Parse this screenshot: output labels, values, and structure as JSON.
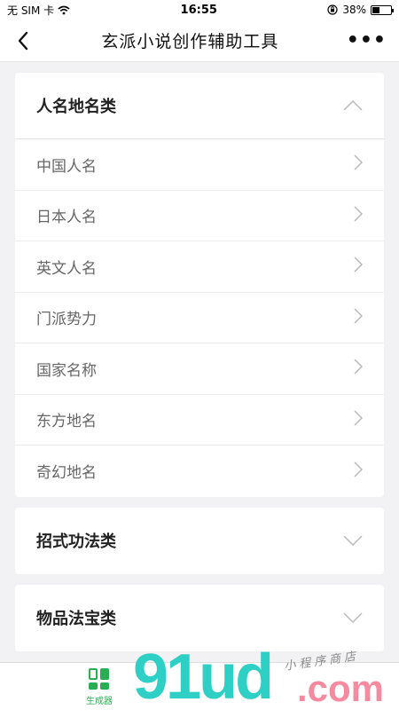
{
  "status_bar": {
    "carrier": "无 SIM 卡",
    "time": "16:55",
    "battery_percent": "38%",
    "battery_level": 0.38
  },
  "nav": {
    "title": "玄派小说创作辅助工具",
    "more": "•••"
  },
  "sections": [
    {
      "title": "人名地名类",
      "expanded": true,
      "items": [
        "中国人名",
        "日本人名",
        "英文人名",
        "门派势力",
        "国家名称",
        "东方地名",
        "奇幻地名"
      ]
    },
    {
      "title": "招式功法类",
      "expanded": false
    },
    {
      "title": "物品法宝类",
      "expanded": false
    }
  ],
  "tab_bar": {
    "tabs": [
      {
        "label": "生成器",
        "icon": "grid-icon",
        "active": true
      }
    ],
    "active_color": "#2aae55"
  },
  "watermark": {
    "logo_text": "91ud",
    "suffix": ".com",
    "tagline": "小程序商店"
  }
}
